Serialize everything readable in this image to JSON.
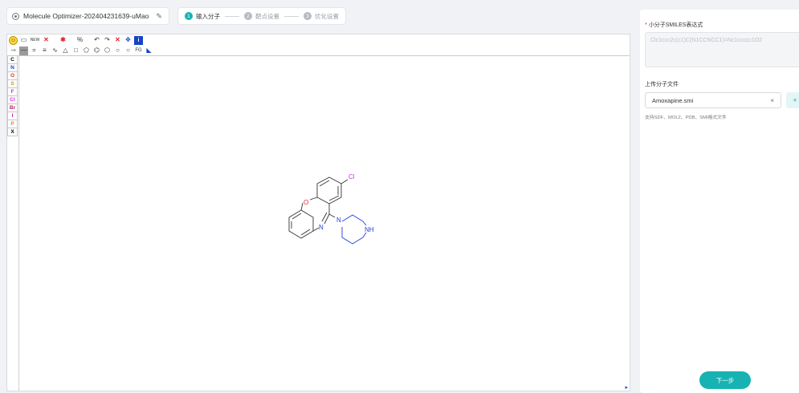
{
  "header": {
    "title": "Molecule Optimizer-202404231639-uMao",
    "steps": [
      {
        "num": "1",
        "label": "输入分子",
        "active": true
      },
      {
        "num": "2",
        "label": "靶点设置",
        "active": false
      },
      {
        "num": "3",
        "label": "优化设置",
        "active": false
      }
    ]
  },
  "editor": {
    "toolbar_row1": [
      "smiley-icon",
      "rectangle-select-icon",
      "new-icon",
      "erase-icon",
      "remove-r-icon",
      "percent-icon",
      "undo-icon",
      "redo-icon",
      "delete-icon",
      "center-icon",
      "info-icon"
    ],
    "new_label": "NEW",
    "fg_label": "FG",
    "atoms": [
      "C",
      "N",
      "O",
      "S",
      "F",
      "Cl",
      "Br",
      "I",
      "P",
      "X"
    ],
    "molecule_labels": {
      "o": "O",
      "n1": "N",
      "n2": "N",
      "nh": "NH",
      "cl": "Cl"
    }
  },
  "panel": {
    "smiles_label": "小分子SMILES表达式",
    "smiles_placeholder": "Clc1ccc2c(c1)C(N1CCNCC1)=Nc1ccccc1O2",
    "upload_label": "上传分子文件",
    "file_name": "Amoxapine.smi",
    "clear_symbol": "×",
    "add_symbol": "+",
    "hint": "支持SDF、MOL2、PDB、SMI格式文件",
    "next_button": "下一步"
  },
  "colors": {
    "accent": "#17b3b3",
    "required": "#e0282e",
    "bond_blue": "#1e3cd8",
    "oxygen": "#e0282e",
    "chlorine": "#d12ee0"
  }
}
